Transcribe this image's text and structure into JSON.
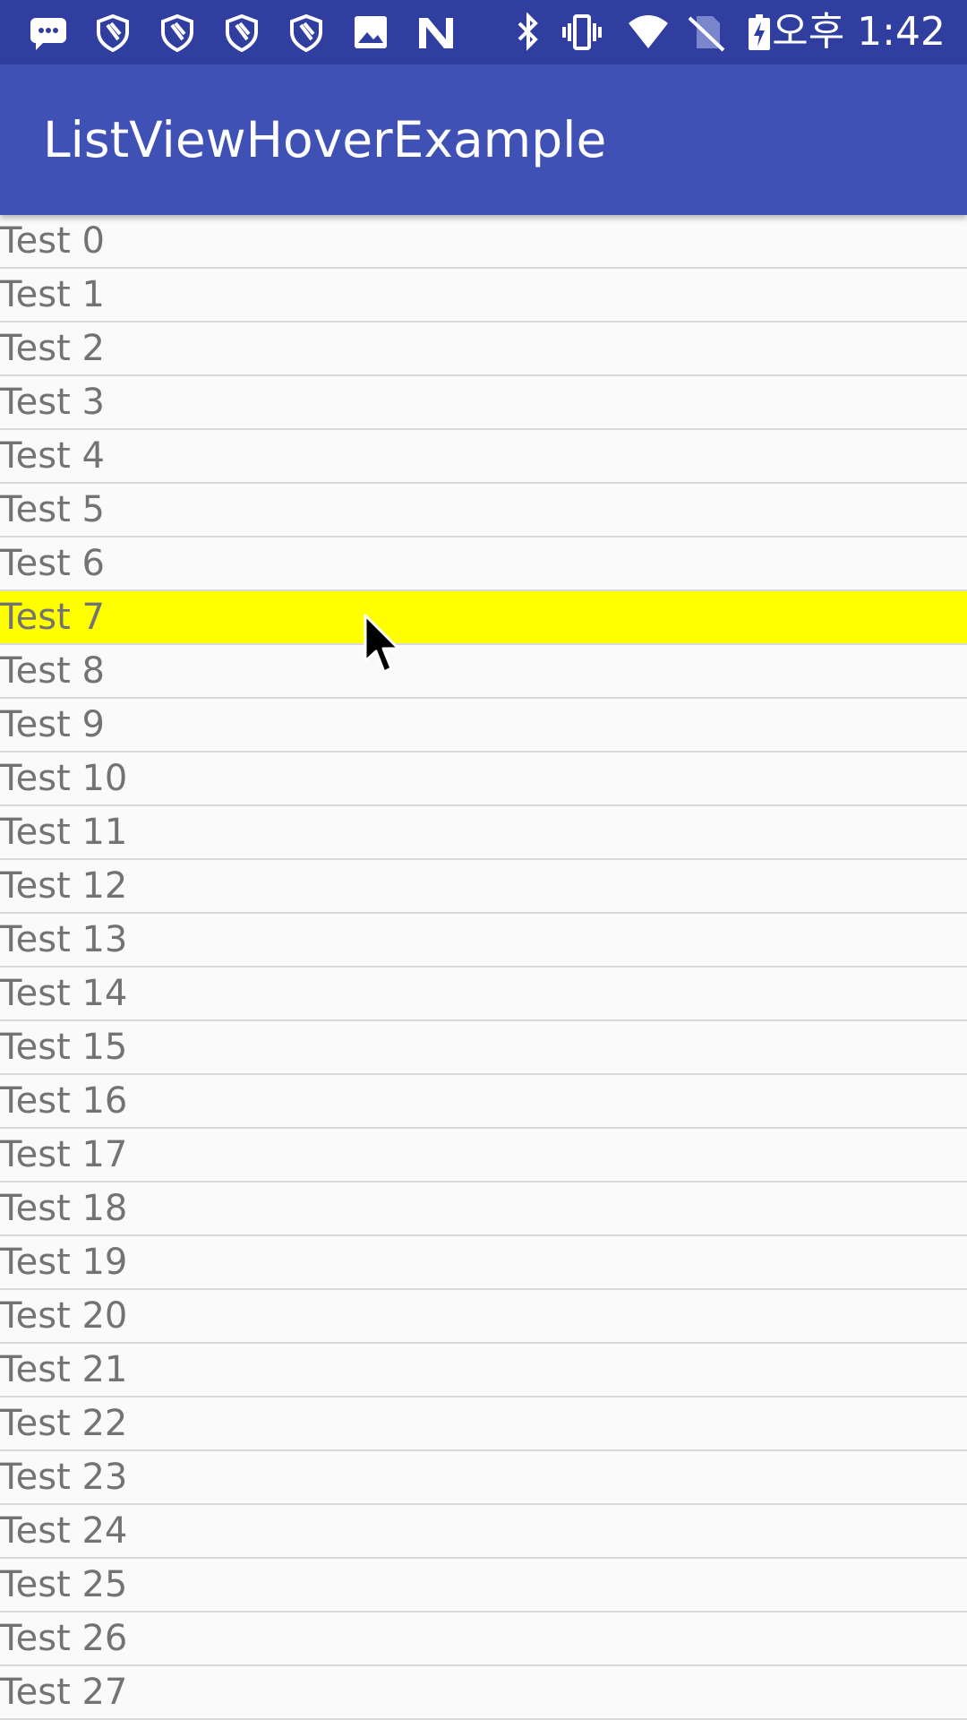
{
  "status_bar": {
    "time": "오후 1:42",
    "left_icons": [
      "message-icon",
      "shield-icon",
      "shield-icon",
      "shield-icon",
      "shield-icon",
      "image-icon",
      "n-logo-icon"
    ],
    "right_icons": [
      "bluetooth-icon",
      "vibrate-icon",
      "wifi-icon",
      "no-sim-icon",
      "battery-charging-icon"
    ],
    "color": "#303f9f"
  },
  "app_bar": {
    "title": "ListViewHoverExample",
    "color": "#3f51b5"
  },
  "list": {
    "items": [
      "Test 0",
      "Test 1",
      "Test 2",
      "Test 3",
      "Test 4",
      "Test 5",
      "Test 6",
      "Test 7",
      "Test 8",
      "Test 9",
      "Test 10",
      "Test 11",
      "Test 12",
      "Test 13",
      "Test 14",
      "Test 15",
      "Test 16",
      "Test 17",
      "Test 18",
      "Test 19",
      "Test 20",
      "Test 21",
      "Test 22",
      "Test 23",
      "Test 24",
      "Test 25",
      "Test 26",
      "Test 27"
    ],
    "hovered_index": 7,
    "hover_color": "#ffff00",
    "text_color": "#737373",
    "divider_color": "#d9d9d9"
  },
  "cursor": {
    "icon": "mouse-pointer-icon"
  }
}
